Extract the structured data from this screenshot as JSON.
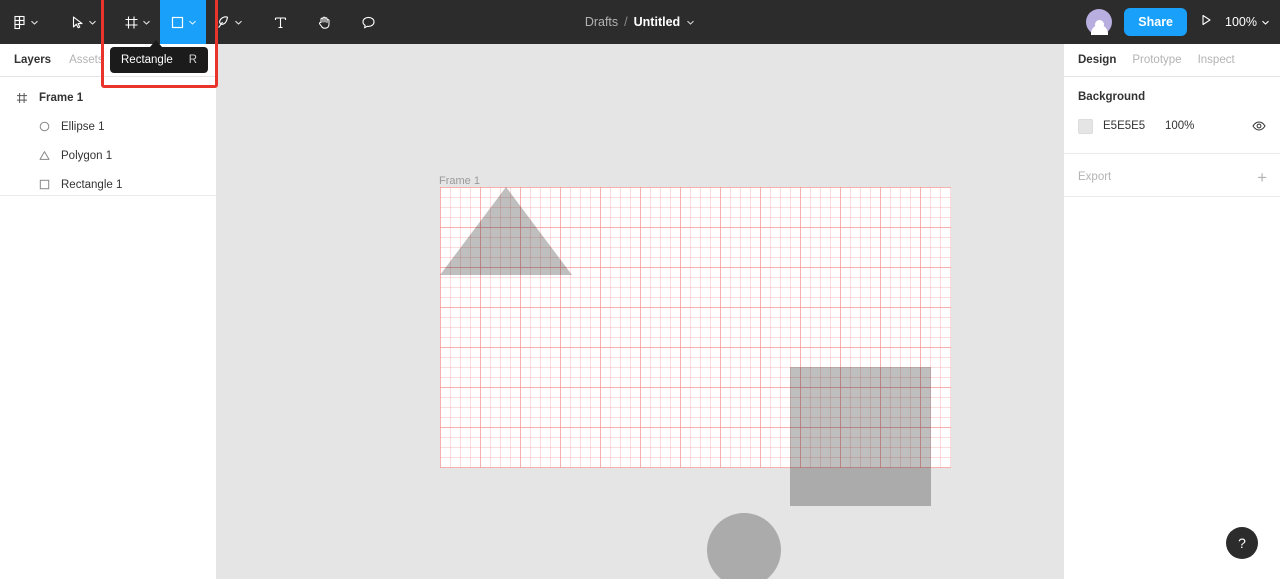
{
  "toolbar": {
    "menu_icon": "figma-logo-icon",
    "tools": [
      {
        "name": "main-menu",
        "icon": "figma-logo-icon",
        "label": "Main menu",
        "has_chevron": true,
        "active": false
      },
      {
        "name": "move-tool",
        "icon": "cursor-arrow-icon",
        "label": "Move",
        "has_chevron": true,
        "active": false
      },
      {
        "name": "frame-tool",
        "icon": "frame-icon",
        "label": "Frame",
        "has_chevron": true,
        "active": false
      },
      {
        "name": "shape-tool",
        "icon": "rectangle-icon",
        "label": "Rectangle",
        "has_chevron": true,
        "active": true
      },
      {
        "name": "pen-tool",
        "icon": "pen-icon",
        "label": "Pen",
        "has_chevron": true,
        "active": false
      },
      {
        "name": "text-tool",
        "icon": "text-icon",
        "label": "Text",
        "has_chevron": false,
        "active": false
      },
      {
        "name": "hand-tool",
        "icon": "hand-icon",
        "label": "Hand",
        "has_chevron": false,
        "active": false
      },
      {
        "name": "comment-tool",
        "icon": "comment-icon",
        "label": "Comment",
        "has_chevron": false,
        "active": false
      }
    ],
    "breadcrumb": {
      "project": "Drafts",
      "separator": "/",
      "file": "Untitled"
    },
    "share_label": "Share",
    "present_icon": "play-icon",
    "zoom_level": "100%",
    "avatar_icon": "user-avatar"
  },
  "tooltip": {
    "label": "Rectangle",
    "shortcut": "R"
  },
  "left_panel": {
    "tabs": [
      {
        "label": "Layers",
        "selected": true
      },
      {
        "label": "Assets",
        "selected": false
      }
    ],
    "layers": [
      {
        "label": "Frame 1",
        "icon": "frame-icon",
        "depth": 0
      },
      {
        "label": "Ellipse 1",
        "icon": "ellipse-icon",
        "depth": 1
      },
      {
        "label": "Polygon 1",
        "icon": "polygon-icon",
        "depth": 1
      },
      {
        "label": "Rectangle 1",
        "icon": "rectangle-icon",
        "depth": 1
      }
    ]
  },
  "canvas": {
    "frame_label": "Frame 1",
    "background_color": "#E5E5E5",
    "frame_fill": "#FFFFFF",
    "grid_color": "#F48C8C",
    "shapes": [
      {
        "name": "rectangle-1",
        "type": "rectangle",
        "fill": "#000000",
        "opacity": "25%"
      },
      {
        "name": "ellipse-1",
        "type": "ellipse",
        "fill": "#000000",
        "opacity": "25%"
      },
      {
        "name": "polygon-1",
        "type": "polygon",
        "fill": "#000000",
        "opacity": "25%"
      }
    ]
  },
  "right_panel": {
    "tabs": [
      {
        "label": "Design",
        "selected": true
      },
      {
        "label": "Prototype",
        "selected": false
      },
      {
        "label": "Inspect",
        "selected": false
      }
    ],
    "background": {
      "title": "Background",
      "hex": "E5E5E5",
      "opacity": "100%",
      "swatch_color": "#E5E5E5",
      "visibility_icon": "eye-icon"
    },
    "export": {
      "title": "Export",
      "add_label": "+"
    }
  },
  "help": {
    "label": "?"
  }
}
